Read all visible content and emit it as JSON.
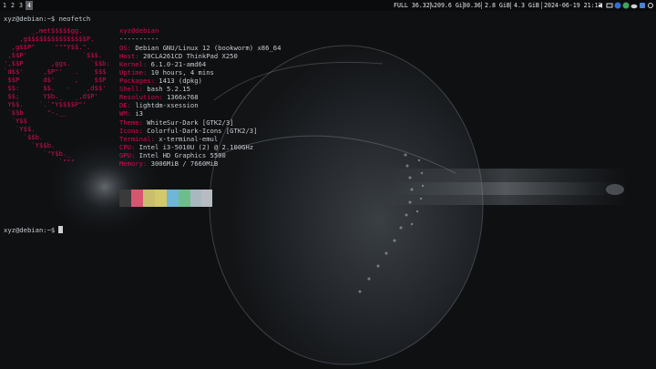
{
  "topbar": {
    "workspaces": [
      "1",
      "2",
      "3",
      "4"
    ],
    "active_workspace": "4",
    "status": {
      "battery": "FULL 36.32%",
      "disk": "209.6 GiB",
      "load": "0.36",
      "mem": "2.8 GiB",
      "swap": "4.3 GiB",
      "datetime": "2024-06-19 21:12"
    }
  },
  "terminal": {
    "prompt1": "xyz@debian:~$ neofetch",
    "logo_lines": [
      "       _,met$$$$$gg.",
      "    ,g$$$$$$$$$$$$$$$P.",
      "  ,g$$P\"     \"\"\"Y$$.\".",
      " ,$$P'              `$$$.",
      "',$$P       ,ggs.     `$$b:",
      "`d$$'     ,$P\"'   .    $$$",
      " $$P      d$'     ,    $$P",
      " $$:      $$.   -    ,d$$'",
      " $$;      Y$b._   _,d$P'",
      " Y$$.    `.`\"Y$$$$P\"'",
      " `$$b      \"-.__",
      "  `Y$$",
      "   `Y$$.",
      "     `$$b.",
      "       `Y$$b.",
      "          `\"Y$b._",
      "              `\"\"\""
    ],
    "user_host": "xyz@debian",
    "underline": "----------",
    "info": [
      {
        "key": "OS",
        "value": "Debian GNU/Linux 12 (bookworm) x86_64"
      },
      {
        "key": "Host",
        "value": "20CLA261CD ThinkPad X250"
      },
      {
        "key": "Kernel",
        "value": "6.1.0-21-amd64"
      },
      {
        "key": "Uptime",
        "value": "10 hours, 4 mins"
      },
      {
        "key": "Packages",
        "value": "1413 (dpkg)"
      },
      {
        "key": "Shell",
        "value": "bash 5.2.15"
      },
      {
        "key": "Resolution",
        "value": "1366x768"
      },
      {
        "key": "DE",
        "value": "lightdm-xsession"
      },
      {
        "key": "WM",
        "value": "i3"
      },
      {
        "key": "Theme",
        "value": "WhiteSur-Dark [GTK2/3]"
      },
      {
        "key": "Icons",
        "value": "Colorful-Dark-Icons [GTK2/3]"
      },
      {
        "key": "Terminal",
        "value": "x-terminal-emul"
      },
      {
        "key": "CPU",
        "value": "Intel i3-5010U (2) @ 2.100GHz"
      },
      {
        "key": "GPU",
        "value": "Intel HD Graphics 5500"
      },
      {
        "key": "Memory",
        "value": "3006MiB / 7660MiB"
      }
    ],
    "palette": [
      "#3a3a3a",
      "#d4566f",
      "#c8be6e",
      "#d3c86a",
      "#6fb6d8",
      "#6cbf8c",
      "#a9b8c0",
      "#b6bcc2"
    ],
    "prompt2": "xyz@debian:~$"
  },
  "colors": {
    "accent": "#d70a53",
    "background": "#0e1012",
    "text": "#c8ccd0"
  }
}
